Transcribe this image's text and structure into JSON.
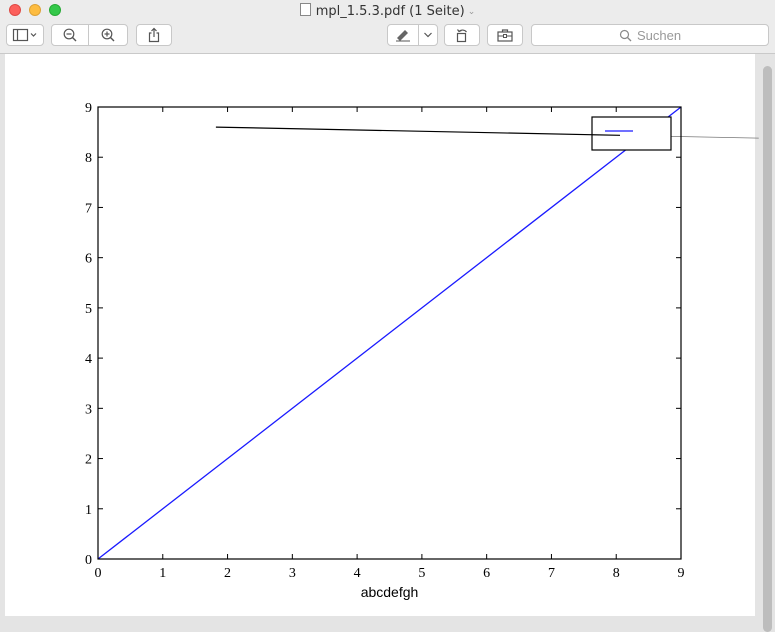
{
  "window": {
    "title": "mpl_1.5.3.pdf (1 Seite)"
  },
  "toolbar": {
    "search_placeholder": "Suchen"
  },
  "colors": {
    "series_line": "#1a1aff",
    "annotation_line": "#000000"
  },
  "chart_data": {
    "type": "line",
    "xlabel": "abcdefgh",
    "ylabel": "",
    "xlim": [
      0,
      9
    ],
    "ylim": [
      0,
      9
    ],
    "xticks": [
      "0",
      "1",
      "2",
      "3",
      "4",
      "5",
      "6",
      "7",
      "8",
      "9"
    ],
    "yticks": [
      "0",
      "1",
      "2",
      "3",
      "4",
      "5",
      "6",
      "7",
      "8",
      "9"
    ],
    "grid": false,
    "legend": "top-right",
    "series": [
      {
        "x": [
          0,
          9
        ],
        "y": [
          0,
          9
        ],
        "color": "#1a1aff"
      }
    ],
    "annotation_line": {
      "x": [
        1.82,
        10.2
      ],
      "y": [
        8.6,
        8.38
      ]
    }
  }
}
